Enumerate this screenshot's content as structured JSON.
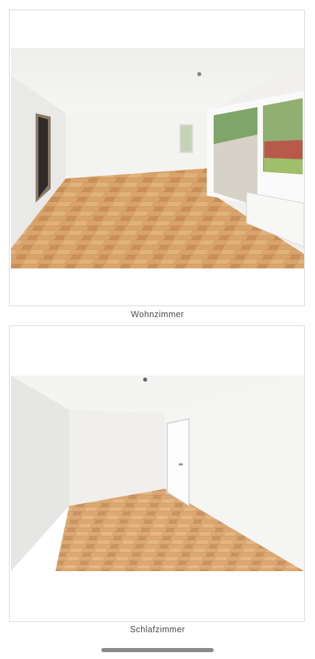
{
  "gallery": {
    "items": [
      {
        "caption": "Wohnzimmer",
        "image_subject": "living-room-photo"
      },
      {
        "caption": "Schlafzimmer",
        "image_subject": "bedroom-photo"
      }
    ]
  },
  "colors": {
    "floor": "#d9a46b",
    "wall": "#f1f0ee",
    "border": "#d9d9d9",
    "caption": "#4a4a4a",
    "home_indicator": "#8a8a8a"
  }
}
